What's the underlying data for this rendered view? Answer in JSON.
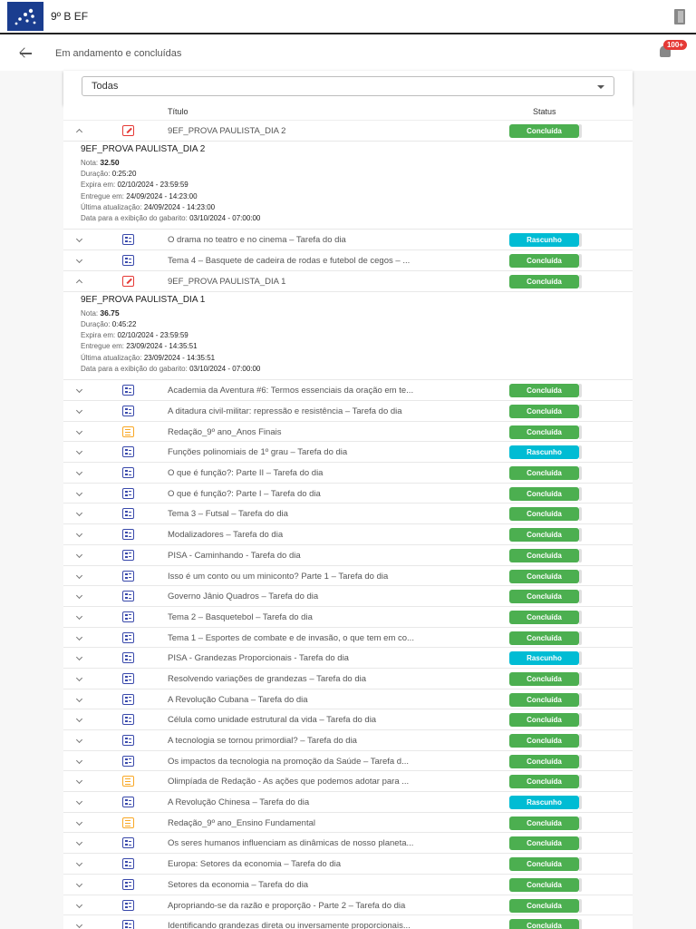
{
  "app": {
    "class_name": "9º B EF"
  },
  "header": {
    "title": "Em andamento e concluídas",
    "notification_badge": "100+"
  },
  "filter": {
    "selected": "Todas"
  },
  "table": {
    "col_title": "Título",
    "col_status": "Status"
  },
  "colors": {
    "concluida": "#4caf50",
    "rascunho": "#00bcd4",
    "brand": "#1a3d8f"
  },
  "rows": [
    {
      "icon": "exam",
      "title": "9EF_PROVA PAULISTA_DIA 2",
      "status": "Concluída",
      "expanded": true,
      "detail": {
        "name": "9EF_PROVA PAULISTA_DIA 2",
        "nota_label": "Nota:",
        "nota": "32.50",
        "duracao_label": "Duração:",
        "duracao": "0:25:20",
        "expira_label": "Expira em:",
        "expira": "02/10/2024 - 23:59:59",
        "entregue_label": "Entregue em:",
        "entregue": "24/09/2024 - 14:23:00",
        "atualizacao_label": "Última atualização:",
        "atualizacao": "24/09/2024 - 14:23:00",
        "gabarito_label": "Data para a exibição do gabarito:",
        "gabarito": "03/10/2024 - 07:00:00"
      }
    },
    {
      "icon": "quiz",
      "title": "O drama no teatro e no cinema – Tarefa do dia",
      "status": "Rascunho"
    },
    {
      "icon": "quiz",
      "title": "Tema 4 – Basquete de cadeira de rodas e futebol de cegos – ...",
      "status": "Concluída"
    },
    {
      "icon": "exam",
      "title": "9EF_PROVA PAULISTA_DIA 1",
      "status": "Concluída",
      "expanded": true,
      "detail": {
        "name": "9EF_PROVA PAULISTA_DIA 1",
        "nota_label": "Nota:",
        "nota": "36.75",
        "duracao_label": "Duração:",
        "duracao": "0:45:22",
        "expira_label": "Expira em:",
        "expira": "02/10/2024 - 23:59:59",
        "entregue_label": "Entregue em:",
        "entregue": "23/09/2024 - 14:35:51",
        "atualizacao_label": "Última atualização:",
        "atualizacao": "23/09/2024 - 14:35:51",
        "gabarito_label": "Data para a exibição do gabarito:",
        "gabarito": "03/10/2024 - 07:00:00"
      }
    },
    {
      "icon": "quiz",
      "title": "Academia da Aventura #6: Termos essenciais da oração em te...",
      "status": "Concluída"
    },
    {
      "icon": "quiz",
      "title": "A ditadura civil-militar: repressão e resistência – Tarefa do dia",
      "status": "Concluída"
    },
    {
      "icon": "essay",
      "title": "Redação_9º ano_Anos Finais",
      "status": "Concluída"
    },
    {
      "icon": "quiz",
      "title": "Funções polinomiais de 1º grau – Tarefa do dia",
      "status": "Rascunho"
    },
    {
      "icon": "quiz",
      "title": "O que é função?: Parte II – Tarefa do dia",
      "status": "Concluída"
    },
    {
      "icon": "quiz",
      "title": "O que é função?: Parte I – Tarefa do dia",
      "status": "Concluída"
    },
    {
      "icon": "quiz",
      "title": "Tema 3 – Futsal – Tarefa do dia",
      "status": "Concluída"
    },
    {
      "icon": "quiz",
      "title": "Modalizadores – Tarefa do dia",
      "status": "Concluída"
    },
    {
      "icon": "quiz",
      "title": "PISA - Caminhando - Tarefa do dia",
      "status": "Concluída"
    },
    {
      "icon": "quiz",
      "title": "Isso é um conto ou um miniconto? Parte 1 – Tarefa do dia",
      "status": "Concluída"
    },
    {
      "icon": "quiz",
      "title": "Governo Jânio Quadros – Tarefa do dia",
      "status": "Concluída"
    },
    {
      "icon": "quiz",
      "title": "Tema 2 – Basquetebol – Tarefa do dia",
      "status": "Concluída"
    },
    {
      "icon": "quiz",
      "title": "Tema 1 – Esportes de combate e de invasão, o que tem em co...",
      "status": "Concluída"
    },
    {
      "icon": "quiz",
      "title": "PISA - Grandezas Proporcionais - Tarefa do dia",
      "status": "Rascunho"
    },
    {
      "icon": "quiz",
      "title": "Resolvendo variações de grandezas – Tarefa do dia",
      "status": "Concluída"
    },
    {
      "icon": "quiz",
      "title": "A Revolução Cubana – Tarefa do dia",
      "status": "Concluída"
    },
    {
      "icon": "quiz",
      "title": "Célula como unidade estrutural da vida – Tarefa do dia",
      "status": "Concluída"
    },
    {
      "icon": "quiz",
      "title": "A tecnologia se tornou primordial? – Tarefa do dia",
      "status": "Concluída"
    },
    {
      "icon": "quiz",
      "title": "Os impactos da tecnologia na promoção da Saúde – Tarefa d...",
      "status": "Concluída"
    },
    {
      "icon": "essay",
      "title": "Olimpíada de Redação - As ações que podemos adotar para ...",
      "status": "Concluída"
    },
    {
      "icon": "quiz",
      "title": "A Revolução Chinesa – Tarefa do dia",
      "status": "Rascunho"
    },
    {
      "icon": "essay",
      "title": "Redação_9º ano_Ensino Fundamental",
      "status": "Concluída"
    },
    {
      "icon": "quiz",
      "title": "Os seres humanos influenciam as dinâmicas de nosso planeta...",
      "status": "Concluída"
    },
    {
      "icon": "quiz",
      "title": "Europa: Setores da economia – Tarefa do dia",
      "status": "Concluída"
    },
    {
      "icon": "quiz",
      "title": "Setores da economia – Tarefa do dia",
      "status": "Concluída"
    },
    {
      "icon": "quiz",
      "title": "Apropriando-se da razão e proporção - Parte 2 – Tarefa do dia",
      "status": "Concluída"
    },
    {
      "icon": "quiz",
      "title": "Identificando grandezas direta ou inversamente proporcionais...",
      "status": "Concluída"
    }
  ]
}
